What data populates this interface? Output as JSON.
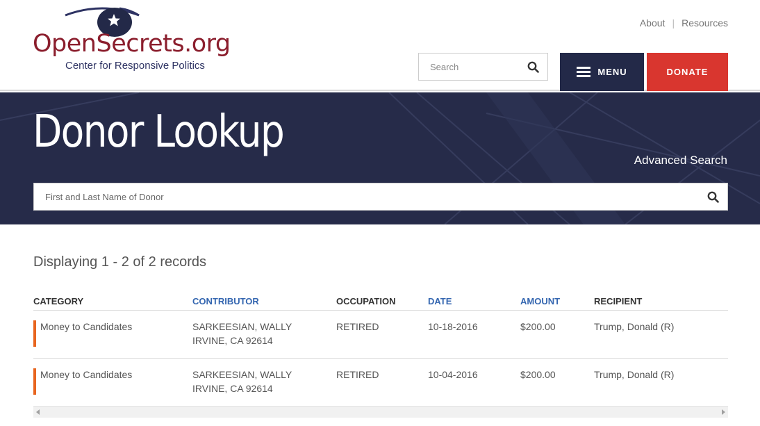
{
  "header": {
    "logo_text": "OpenSecrets.org",
    "logo_subtitle": "Center for Responsive Politics",
    "top_links": [
      {
        "label": "About"
      },
      {
        "label": "Resources"
      }
    ],
    "search_placeholder": "Search",
    "menu_label": "MENU",
    "donate_label": "DONATE"
  },
  "banner": {
    "title": "Donor Lookup",
    "advanced_search": "Advanced Search",
    "donor_search_placeholder": "First and Last Name of Donor"
  },
  "results": {
    "records_text": "Displaying 1 - 2 of 2 records",
    "columns": [
      {
        "label": "CATEGORY",
        "sortable": false
      },
      {
        "label": "CONTRIBUTOR",
        "sortable": true
      },
      {
        "label": "OCCUPATION",
        "sortable": false
      },
      {
        "label": "DATE",
        "sortable": true
      },
      {
        "label": "AMOUNT",
        "sortable": true
      },
      {
        "label": "RECIPIENT",
        "sortable": false
      }
    ],
    "rows": [
      {
        "category": "Money to Candidates",
        "contributor_name": "SARKEESIAN, WALLY",
        "contributor_location": "IRVINE, CA 92614",
        "occupation": "RETIRED",
        "date": "10-18-2016",
        "amount": "$200.00",
        "recipient": "Trump, Donald (R)"
      },
      {
        "category": "Money to Candidates",
        "contributor_name": "SARKEESIAN, WALLY",
        "contributor_location": "IRVINE, CA 92614",
        "occupation": "RETIRED",
        "date": "10-04-2016",
        "amount": "$200.00",
        "recipient": "Trump, Donald (R)"
      }
    ]
  },
  "colors": {
    "brand_red": "#8b1e2d",
    "navy": "#232948",
    "donate_red": "#d9362f",
    "link_blue": "#3466b0",
    "category_bar": "#e8651f"
  }
}
